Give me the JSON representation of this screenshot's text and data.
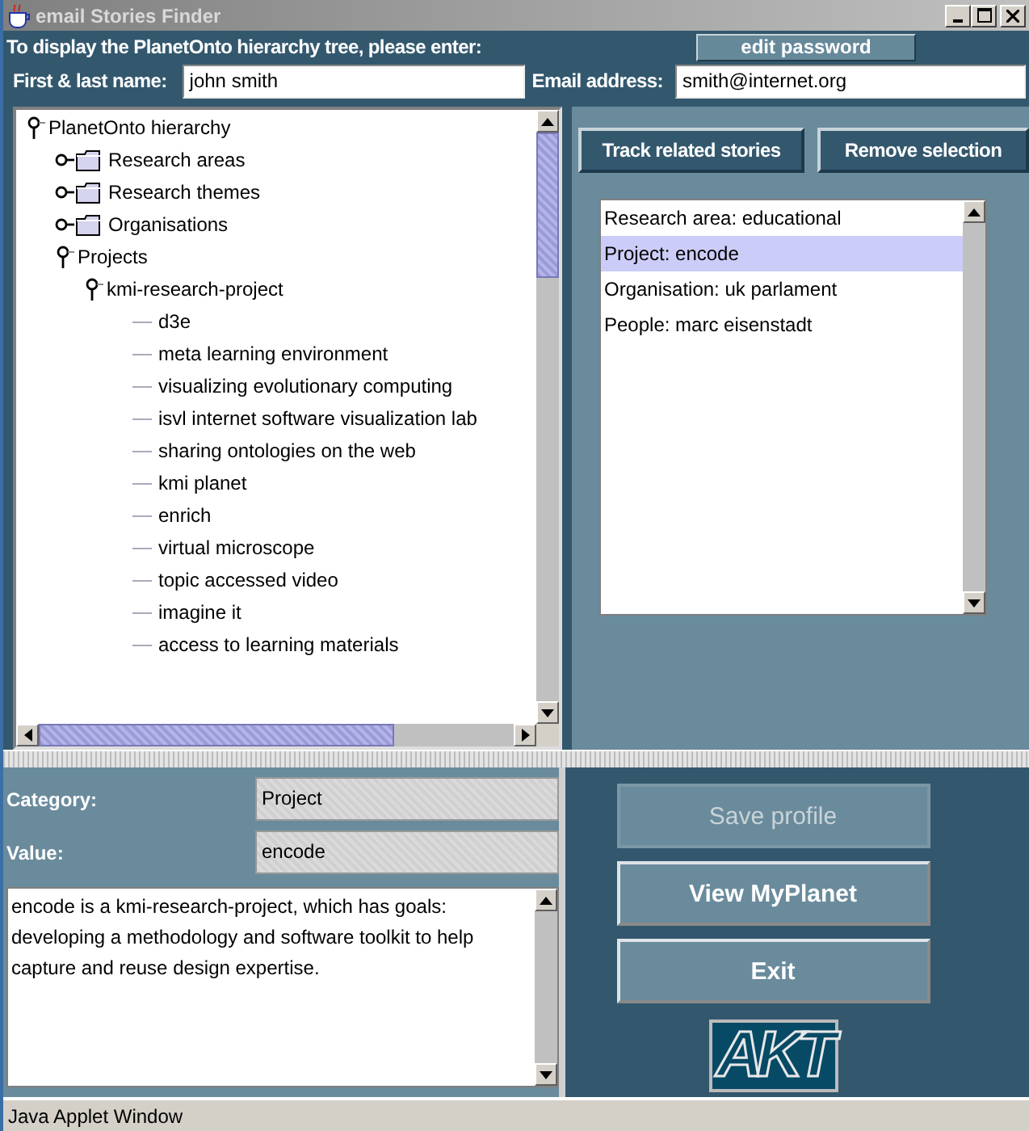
{
  "window": {
    "title": "email Stories Finder"
  },
  "header": {
    "prompt": "To display the PlanetOnto hierarchy tree, please enter:",
    "edit_password_button": "edit password",
    "name_label": "First & last name:",
    "name_value": "john smith",
    "email_label": "Email address:",
    "email_value": "smith@internet.org"
  },
  "tree": [
    {
      "label": "PlanetOnto hierarchy",
      "kind": "branch",
      "expanded": true,
      "children": [
        {
          "label": "Research areas",
          "kind": "branch",
          "expanded": false
        },
        {
          "label": "Research themes",
          "kind": "branch",
          "expanded": false
        },
        {
          "label": "Organisations",
          "kind": "branch",
          "expanded": false
        },
        {
          "label": "Projects",
          "kind": "branch",
          "expanded": true,
          "children": [
            {
              "label": "kmi-research-project",
              "kind": "branch",
              "expanded": true,
              "children": [
                {
                  "label": "d3e",
                  "kind": "leaf"
                },
                {
                  "label": "meta learning environment",
                  "kind": "leaf"
                },
                {
                  "label": "visualizing evolutionary computing",
                  "kind": "leaf"
                },
                {
                  "label": "isvl internet software visualization lab",
                  "kind": "leaf"
                },
                {
                  "label": "sharing ontologies on the web",
                  "kind": "leaf"
                },
                {
                  "label": "kmi planet",
                  "kind": "leaf"
                },
                {
                  "label": "enrich",
                  "kind": "leaf"
                },
                {
                  "label": "virtual microscope",
                  "kind": "leaf"
                },
                {
                  "label": "topic accessed video",
                  "kind": "leaf"
                },
                {
                  "label": "imagine it",
                  "kind": "leaf"
                },
                {
                  "label": "access to learning materials",
                  "kind": "leaf"
                }
              ]
            }
          ]
        }
      ]
    }
  ],
  "track_button": "Track related stories",
  "remove_button": "Remove selection",
  "selection_list": [
    {
      "label": "Research area: educational",
      "selected": false
    },
    {
      "label": "Project: encode",
      "selected": true
    },
    {
      "label": "Organisation: uk parlament",
      "selected": false
    },
    {
      "label": "People: marc eisenstadt",
      "selected": false
    }
  ],
  "details": {
    "category_label": "Category:",
    "category_value": "Project",
    "value_label": "Value:",
    "value_value": "encode",
    "description": "encode is a  kmi-research-project, which has goals: developing a methodology and software toolkit to help capture and reuse design expertise."
  },
  "actions": [
    {
      "label": "Save profile",
      "disabled": true
    },
    {
      "label": "View MyPlanet",
      "disabled": false
    },
    {
      "label": "Exit",
      "disabled": false
    }
  ],
  "logo": "AKT",
  "status_bar": "Java Applet Window"
}
